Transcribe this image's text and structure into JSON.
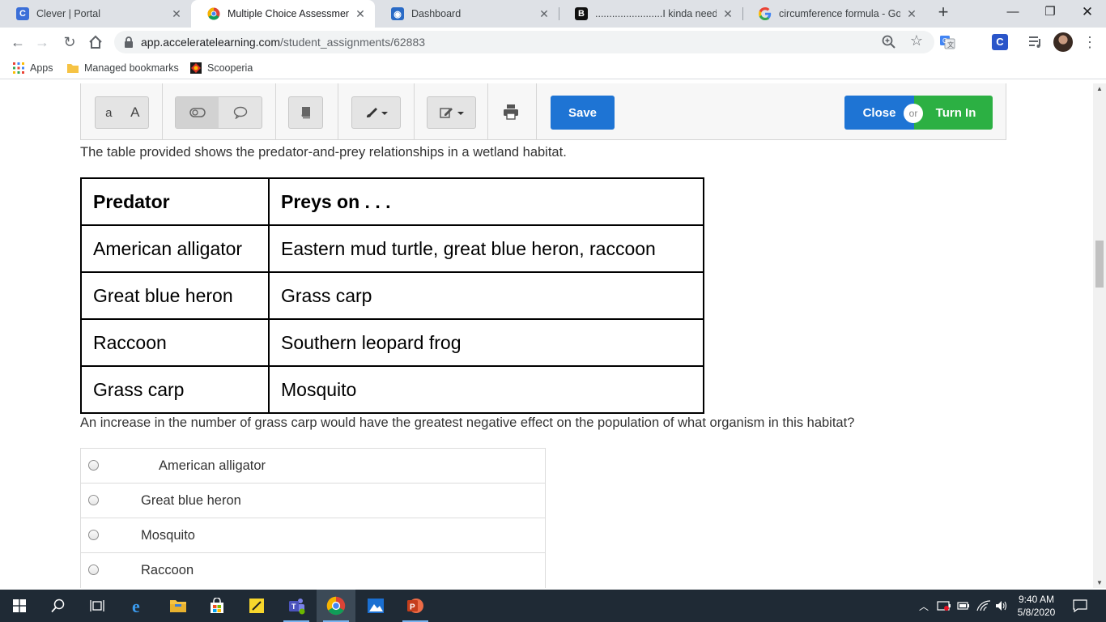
{
  "browser": {
    "tabs": [
      {
        "title": "Clever | Portal",
        "favicon": "clever-icon",
        "active": false
      },
      {
        "title": "Multiple Choice Assessment fr",
        "favicon": "chrome-icon",
        "active": true
      },
      {
        "title": "Dashboard",
        "favicon": "dashboard-icon",
        "active": false
      },
      {
        "title": "........................I kinda need he",
        "favicon": "brainly-icon",
        "active": false
      },
      {
        "title": "circumference formula - Goog",
        "favicon": "google-icon",
        "active": false
      }
    ],
    "url_host": "app.acceleratelearning.com",
    "url_path": "/student_assignments/62883",
    "bookmarks": [
      {
        "label": "Apps",
        "icon": "apps-grid-icon"
      },
      {
        "label": "Managed bookmarks",
        "icon": "folder-icon"
      },
      {
        "label": "Scooperia",
        "icon": "scooperia-icon"
      }
    ]
  },
  "toolbar": {
    "font_small": "a",
    "font_large": "A",
    "save_label": "Save",
    "close_label": "Close",
    "or_label": "or",
    "turn_in_label": "Turn In"
  },
  "question": {
    "intro": "The table provided shows the predator-and-prey relationships in a wetland habitat.",
    "table": {
      "headers": [
        "Predator",
        "Preys on . . ."
      ],
      "rows": [
        [
          "American alligator",
          "Eastern mud turtle, great blue heron, raccoon"
        ],
        [
          "Great blue heron",
          "Grass carp"
        ],
        [
          "Raccoon",
          "Southern leopard frog"
        ],
        [
          "Grass carp",
          "Mosquito"
        ]
      ]
    },
    "prompt": "An increase in the number of grass carp would have the greatest negative effect on the population of what organism in this habitat?",
    "choices": [
      "American alligator",
      "Great blue heron",
      "Mosquito",
      "Raccoon"
    ]
  },
  "taskbar": {
    "time": "9:40 AM",
    "date": "5/8/2020"
  },
  "colors": {
    "save_blue": "#1e74d4",
    "turn_in_green": "#2cb043",
    "taskbar_bg": "#1f2a35"
  }
}
